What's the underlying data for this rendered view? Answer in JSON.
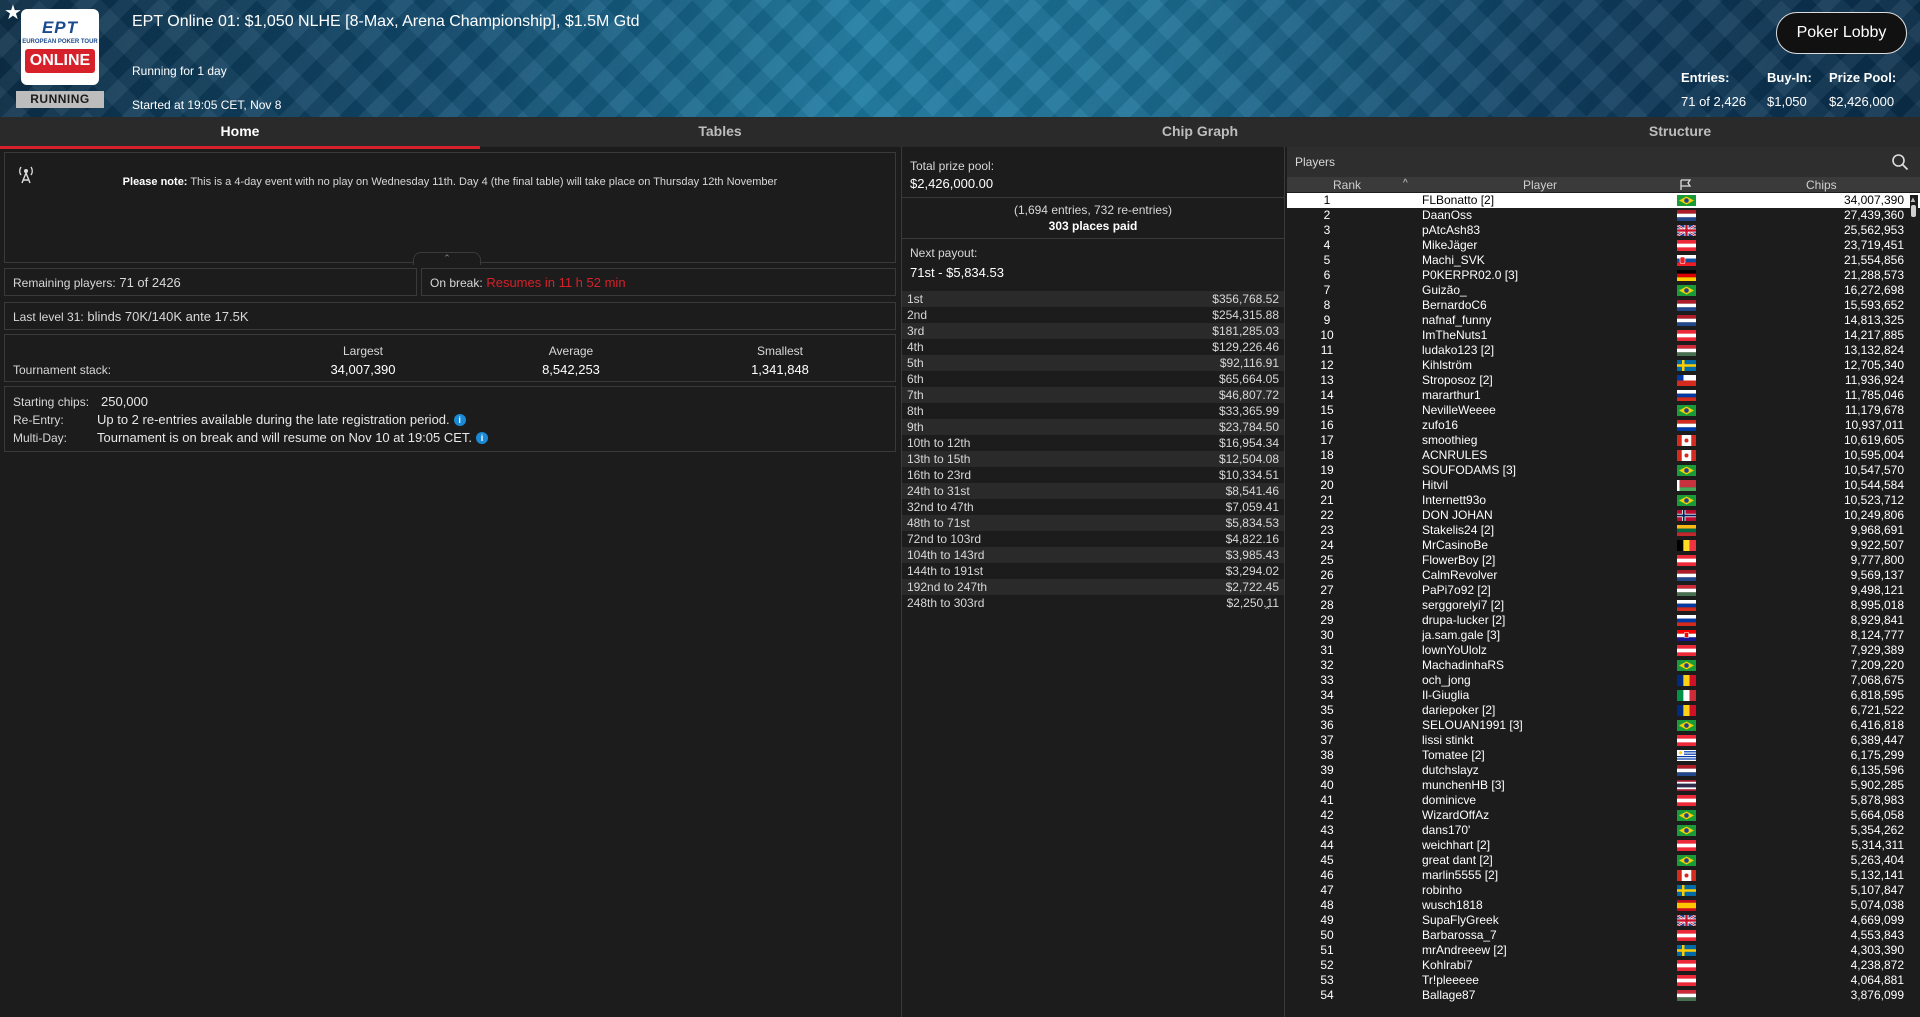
{
  "header": {
    "title": "EPT Online 01: $1,050 NLHE [8-Max, Arena Championship], $1.5M Gtd",
    "running_for": "Running for 1 day",
    "started_at": "Started at 19:05 CET, Nov 8",
    "status": "RUNNING",
    "logo": {
      "line1": "EPT",
      "line2": "EUROPEAN POKER TOUR",
      "line3": "ONLINE"
    },
    "lobby_button": "Poker Lobby",
    "entries_label": "Entries:",
    "entries_value": "71 of 2,426",
    "buyin_label": "Buy-In:",
    "buyin_value": "$1,050",
    "prize_label": "Prize Pool:",
    "prize_value": "$2,426,000"
  },
  "tabs": [
    {
      "label": "Home",
      "active": true
    },
    {
      "label": "Tables",
      "active": false
    },
    {
      "label": "Chip Graph",
      "active": false
    },
    {
      "label": "Structure",
      "active": false
    }
  ],
  "note": {
    "bold": "Please note:",
    "text": " This is a 4-day event with no play on Wednesday 11th. Day 4 (the final table) will take place on Thursday 12th November"
  },
  "remaining": {
    "label": "Remaining players:",
    "value": "71 of 2426"
  },
  "on_break": {
    "label": "On break:",
    "value": "Resumes in 11 h 52 min"
  },
  "last_level": {
    "label": "Last level 31:",
    "value": "blinds 70K/140K ante 17.5K"
  },
  "stack": {
    "label": "Tournament stack:",
    "largest_label": "Largest",
    "largest": "34,007,390",
    "average_label": "Average",
    "average": "8,542,253",
    "smallest_label": "Smallest",
    "smallest": "1,341,848"
  },
  "info": {
    "starting_label": "Starting chips:",
    "starting_value": "250,000",
    "reentry_label": "Re-Entry:",
    "reentry_value": "Up to 2 re-entries available during the late registration period.",
    "multiday_label": "Multi-Day:",
    "multiday_value": "Tournament is on break and will resume on Nov 10 at 19:05 CET."
  },
  "prize": {
    "total_label": "Total prize pool:",
    "total_value": "$2,426,000.00",
    "entries_line": "(1,694 entries, 732 re-entries)",
    "paid_line": "303 places paid",
    "next_label": "Next payout:",
    "next_value": "71st - $5,834.53",
    "payouts": [
      {
        "place": "1st",
        "amount": "$356,768.52"
      },
      {
        "place": "2nd",
        "amount": "$254,315.88"
      },
      {
        "place": "3rd",
        "amount": "$181,285.03"
      },
      {
        "place": "4th",
        "amount": "$129,226.46"
      },
      {
        "place": "5th",
        "amount": "$92,116.91"
      },
      {
        "place": "6th",
        "amount": "$65,664.05"
      },
      {
        "place": "7th",
        "amount": "$46,807.72"
      },
      {
        "place": "8th",
        "amount": "$33,365.99"
      },
      {
        "place": "9th",
        "amount": "$23,784.50"
      },
      {
        "place": "10th to 12th",
        "amount": "$16,954.34"
      },
      {
        "place": "13th to 15th",
        "amount": "$12,504.08"
      },
      {
        "place": "16th to 23rd",
        "amount": "$10,334.51"
      },
      {
        "place": "24th to 31st",
        "amount": "$8,541.46"
      },
      {
        "place": "32nd to 47th",
        "amount": "$7,059.41"
      },
      {
        "place": "48th to 71st",
        "amount": "$5,834.53"
      },
      {
        "place": "72nd to 103rd",
        "amount": "$4,822.16"
      },
      {
        "place": "104th to 143rd",
        "amount": "$3,985.43"
      },
      {
        "place": "144th to 191st",
        "amount": "$3,294.02"
      },
      {
        "place": "192nd to 247th",
        "amount": "$2,722.45"
      },
      {
        "place": "248th to 303rd",
        "amount": "$2,250.11"
      }
    ]
  },
  "players": {
    "title": "Players",
    "col_rank": "Rank",
    "col_player": "Player",
    "col_chips": "Chips",
    "rows": [
      {
        "rank": "1",
        "name": "FLBonatto [2]",
        "flag": "br",
        "chips": "34,007,390"
      },
      {
        "rank": "2",
        "name": "DaanOss",
        "flag": "nl",
        "chips": "27,439,360"
      },
      {
        "rank": "3",
        "name": "pAtcAsh83",
        "flag": "gb",
        "chips": "25,562,953"
      },
      {
        "rank": "4",
        "name": "MikeJäger",
        "flag": "at",
        "chips": "23,719,451"
      },
      {
        "rank": "5",
        "name": "Machi_SVK",
        "flag": "sk",
        "chips": "21,554,856"
      },
      {
        "rank": "6",
        "name": "P0KERPR02.0 [3]",
        "flag": "de",
        "chips": "21,288,573"
      },
      {
        "rank": "7",
        "name": "Guizão_",
        "flag": "br",
        "chips": "16,272,698"
      },
      {
        "rank": "8",
        "name": "BernardoC6",
        "flag": "nl",
        "chips": "15,593,652"
      },
      {
        "rank": "9",
        "name": "nafnaf_funny",
        "flag": "nl",
        "chips": "14,813,325"
      },
      {
        "rank": "10",
        "name": "ImTheNuts1",
        "flag": "at",
        "chips": "14,217,885"
      },
      {
        "rank": "11",
        "name": "ludako123 [2]",
        "flag": "hu",
        "chips": "13,132,824"
      },
      {
        "rank": "12",
        "name": "Kihlström",
        "flag": "se",
        "chips": "12,705,340"
      },
      {
        "rank": "13",
        "name": "Stroposoz [2]",
        "flag": "cl",
        "chips": "11,936,924"
      },
      {
        "rank": "14",
        "name": "mararthur1",
        "flag": "ru",
        "chips": "11,785,046"
      },
      {
        "rank": "15",
        "name": "NevilleWeeee",
        "flag": "br",
        "chips": "11,179,678"
      },
      {
        "rank": "16",
        "name": "zufo16",
        "flag": "py",
        "chips": "10,937,011"
      },
      {
        "rank": "17",
        "name": "smoothieg",
        "flag": "ca",
        "chips": "10,619,605"
      },
      {
        "rank": "18",
        "name": "ACNRULES",
        "flag": "ca",
        "chips": "10,595,004"
      },
      {
        "rank": "19",
        "name": "SOUFODAMS [3]",
        "flag": "br",
        "chips": "10,547,570"
      },
      {
        "rank": "20",
        "name": "Hitvil",
        "flag": "by",
        "chips": "10,544,584"
      },
      {
        "rank": "21",
        "name": "Internett93o",
        "flag": "br",
        "chips": "10,523,712"
      },
      {
        "rank": "22",
        "name": "DON JOHAN",
        "flag": "no",
        "chips": "10,249,806"
      },
      {
        "rank": "23",
        "name": "Stakelis24 [2]",
        "flag": "lt",
        "chips": "9,968,691"
      },
      {
        "rank": "24",
        "name": "MrCasinoBe",
        "flag": "be",
        "chips": "9,922,507"
      },
      {
        "rank": "25",
        "name": "FlowerBoy [2]",
        "flag": "at",
        "chips": "9,777,800"
      },
      {
        "rank": "26",
        "name": "CalmRevolver",
        "flag": "nl",
        "chips": "9,569,137"
      },
      {
        "rank": "27",
        "name": "PaPi7o92 [2]",
        "flag": "hu",
        "chips": "9,498,121"
      },
      {
        "rank": "28",
        "name": "serggorelyi7 [2]",
        "flag": "ru",
        "chips": "8,995,018"
      },
      {
        "rank": "29",
        "name": "drupa-lucker [2]",
        "flag": "ru",
        "chips": "8,929,841"
      },
      {
        "rank": "30",
        "name": "ja.sam.gale [3]",
        "flag": "hr",
        "chips": "8,124,777"
      },
      {
        "rank": "31",
        "name": "lownYoUlolz",
        "flag": "at",
        "chips": "7,929,389"
      },
      {
        "rank": "32",
        "name": "MachadinhaRS",
        "flag": "br",
        "chips": "7,209,220"
      },
      {
        "rank": "33",
        "name": "och_jong",
        "flag": "ro",
        "chips": "7,068,675"
      },
      {
        "rank": "34",
        "name": "Il-Giuglia",
        "flag": "it",
        "chips": "6,818,595"
      },
      {
        "rank": "35",
        "name": "dariepoker [2]",
        "flag": "ro",
        "chips": "6,721,522"
      },
      {
        "rank": "36",
        "name": "SELOUAN1991 [3]",
        "flag": "br",
        "chips": "6,416,818"
      },
      {
        "rank": "37",
        "name": "lissi stinkt",
        "flag": "at",
        "chips": "6,389,447"
      },
      {
        "rank": "38",
        "name": "Tomatee [2]",
        "flag": "uy",
        "chips": "6,175,299"
      },
      {
        "rank": "39",
        "name": "dutchslayz",
        "flag": "nl",
        "chips": "6,135,596"
      },
      {
        "rank": "40",
        "name": "munchenHB [3]",
        "flag": "th",
        "chips": "5,902,285"
      },
      {
        "rank": "41",
        "name": "dominicve",
        "flag": "at",
        "chips": "5,878,983"
      },
      {
        "rank": "42",
        "name": "WizardOffAz",
        "flag": "br",
        "chips": "5,664,058"
      },
      {
        "rank": "43",
        "name": "dans170'",
        "flag": "br",
        "chips": "5,354,262"
      },
      {
        "rank": "44",
        "name": "weichhart [2]",
        "flag": "at",
        "chips": "5,314,311"
      },
      {
        "rank": "45",
        "name": "great dant [2]",
        "flag": "br",
        "chips": "5,263,404"
      },
      {
        "rank": "46",
        "name": "marlin5555 [2]",
        "flag": "ca",
        "chips": "5,132,141"
      },
      {
        "rank": "47",
        "name": "robinho",
        "flag": "se",
        "chips": "5,107,847"
      },
      {
        "rank": "48",
        "name": "wusch1818",
        "flag": "es",
        "chips": "5,074,038"
      },
      {
        "rank": "49",
        "name": "SupaFlyGreek",
        "flag": "gb",
        "chips": "4,669,099"
      },
      {
        "rank": "50",
        "name": "Barbarossa_7",
        "flag": "at",
        "chips": "4,553,843"
      },
      {
        "rank": "51",
        "name": "mrAndreeew [2]",
        "flag": "se",
        "chips": "4,303,390"
      },
      {
        "rank": "52",
        "name": "Kohlrabi7",
        "flag": "at",
        "chips": "4,238,872"
      },
      {
        "rank": "53",
        "name": "Tr!pleeeee",
        "flag": "at",
        "chips": "4,064,881"
      },
      {
        "rank": "54",
        "name": "Ballage87",
        "flag": "hu",
        "chips": "3,876,099"
      }
    ]
  },
  "colors": {
    "accent_red": "#d6202a",
    "info_blue": "#1a8ad6",
    "background": "#1c1c1c"
  }
}
